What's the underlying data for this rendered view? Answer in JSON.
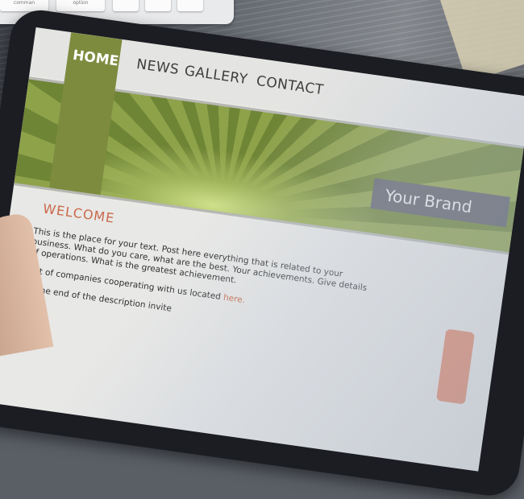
{
  "keyboard": {
    "keys": [
      "comman",
      "option",
      "",
      "",
      ""
    ]
  },
  "site": {
    "nav": {
      "home": "HOME",
      "news": "NEWS",
      "gallery": "GALLERY",
      "contact": "CONTACT"
    },
    "brand": "Your Brand",
    "welcome": "WELCOME",
    "paragraph_1": "This is the place for your text. Post here everything that is related to your business. What do you care, what are the best. Your achievements. Give details of operations. What is the greatest achievement.",
    "paragraph_2": "List of companies cooperating with us located",
    "paragraph_2_link": "here.",
    "paragraph_3": "At the end of the description invite"
  }
}
